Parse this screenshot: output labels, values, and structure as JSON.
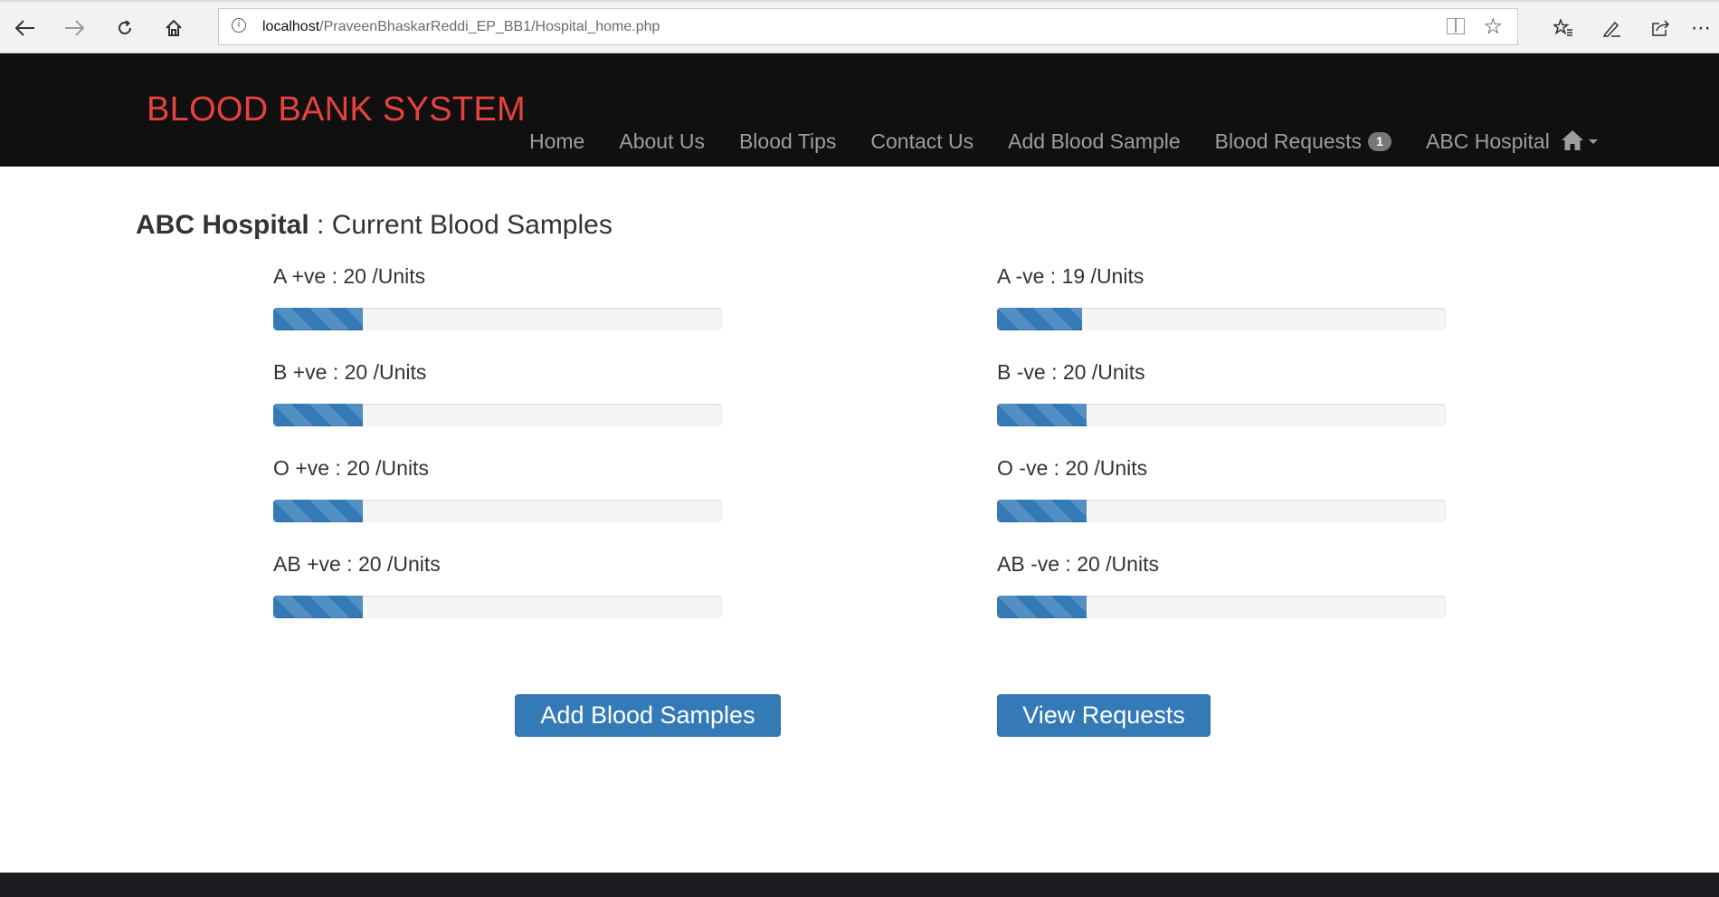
{
  "browser": {
    "url_host": "localhost",
    "url_path": "/PraveenBhaskarReddi_EP_BB1/Hospital_home.php",
    "icons": [
      "back-icon",
      "forward-icon",
      "refresh-icon",
      "home-icon",
      "info-icon",
      "reading-view-icon",
      "favorite-star-icon",
      "favorites-list-icon",
      "pen-icon",
      "share-icon",
      "more-icon"
    ]
  },
  "navbar": {
    "brand": "BLOOD BANK SYSTEM",
    "brand_color": "#e8413e",
    "items": {
      "home": "Home",
      "about": "About Us",
      "tips": "Blood Tips",
      "contact": "Contact Us",
      "add_sample": "Add Blood Sample",
      "requests": "Blood Requests",
      "requests_badge": "1",
      "account": "ABC Hospital"
    }
  },
  "main": {
    "hospital": "ABC Hospital",
    "subtitle": " : Current Blood Samples",
    "samples": [
      {
        "label": "A +ve : 20 /Units",
        "units": 20,
        "fill_percent": 20
      },
      {
        "label": "A -ve : 19 /Units",
        "units": 19,
        "fill_percent": 19
      },
      {
        "label": "B +ve : 20 /Units",
        "units": 20,
        "fill_percent": 20
      },
      {
        "label": "B -ve : 20 /Units",
        "units": 20,
        "fill_percent": 20
      },
      {
        "label": "O +ve : 20 /Units",
        "units": 20,
        "fill_percent": 20
      },
      {
        "label": "O -ve : 20 /Units",
        "units": 20,
        "fill_percent": 20
      },
      {
        "label": "AB +ve : 20 /Units",
        "units": 20,
        "fill_percent": 20
      },
      {
        "label": "AB -ve : 20 /Units",
        "units": 20,
        "fill_percent": 20
      }
    ],
    "buttons": {
      "add": "Add Blood Samples",
      "view": "View Requests"
    },
    "accent_color": "#337ab7"
  }
}
